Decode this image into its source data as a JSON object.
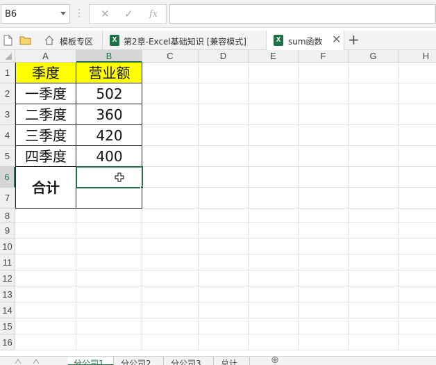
{
  "formula_bar": {
    "name_box": "B6",
    "cancel_icon": "✕",
    "confirm_icon": "✓",
    "fx_icon": "fx",
    "formula_value": ""
  },
  "doc_tabs": {
    "items": [
      {
        "label": "模板专区"
      },
      {
        "label": "第2章-Excel基础知识 [兼容模式]"
      },
      {
        "label": "sum函数"
      }
    ],
    "xls_icon_letter": "X",
    "close_icon": "✕",
    "new_tab_icon": "+"
  },
  "columns": [
    "A",
    "B",
    "C",
    "D",
    "E",
    "F",
    "G",
    "H"
  ],
  "rows": [
    "1",
    "2",
    "3",
    "4",
    "5",
    "6",
    "7",
    "8",
    "9",
    "10",
    "11",
    "12",
    "13",
    "14",
    "15",
    "16"
  ],
  "selected_cell": "B6",
  "cells": {
    "A1": "季度",
    "B1": "营业额",
    "A2": "一季度",
    "B2": "502",
    "A3": "二季度",
    "B3": "360",
    "A4": "三季度",
    "B4": "420",
    "A5": "四季度",
    "B5": "400",
    "A6": "合计",
    "B6": ""
  },
  "header_fill_color": "#ffff00",
  "sheet_tabs": [
    {
      "label": "分公司1",
      "active": true
    },
    {
      "label": "分公司2",
      "active": false
    },
    {
      "label": "分公司3",
      "active": false
    },
    {
      "label": "总计",
      "active": false
    }
  ],
  "add_sheet_icon": "⊕",
  "accent_color": "#217346"
}
